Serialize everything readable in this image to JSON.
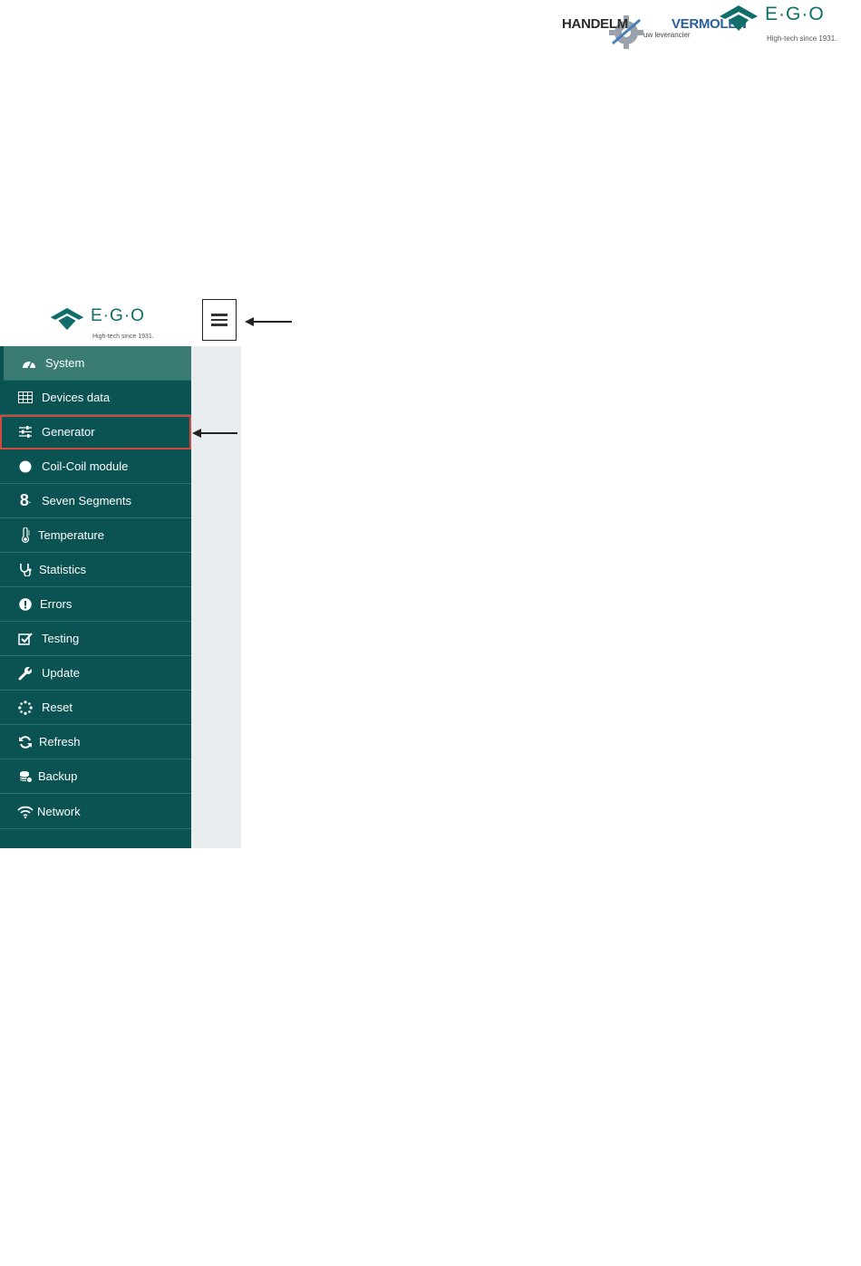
{
  "header": {
    "partner_logo": {
      "text_part1": "HANDELM",
      "text_part2": "VERMOLEN",
      "tagline": "uw leverancier"
    },
    "brand_logo": {
      "letters": "E·G·O",
      "tagline": "High-tech since 1931."
    }
  },
  "app": {
    "logo": {
      "letters": "E·G·O",
      "tagline": "High-tech since 1931."
    },
    "menu_button": "hamburger-icon",
    "sidebar": {
      "items": [
        {
          "label": "System",
          "icon": "dashboard-icon",
          "active": true
        },
        {
          "label": "Devices data",
          "icon": "table-icon"
        },
        {
          "label": "Generator",
          "icon": "sliders-icon",
          "highlighted": true
        },
        {
          "label": "Coil-Coil module",
          "icon": "circle-icon"
        },
        {
          "label": "Seven Segments",
          "icon": "seven-segment-icon"
        },
        {
          "label": "Temperature",
          "icon": "thermometer-icon"
        },
        {
          "label": "Statistics",
          "icon": "stethoscope-icon"
        },
        {
          "label": "Errors",
          "icon": "exclamation-icon"
        },
        {
          "label": "Testing",
          "icon": "check-square-icon"
        },
        {
          "label": "Update",
          "icon": "wrench-icon"
        },
        {
          "label": "Reset",
          "icon": "spinner-icon"
        },
        {
          "label": "Refresh",
          "icon": "refresh-icon"
        },
        {
          "label": "Backup",
          "icon": "database-icon"
        },
        {
          "label": "Network",
          "icon": "wifi-icon"
        }
      ]
    }
  },
  "colors": {
    "sidebar": "#0b5252",
    "active": "#3a7c73",
    "highlight": "#d14b3d",
    "brand": "#0f6e6a"
  }
}
